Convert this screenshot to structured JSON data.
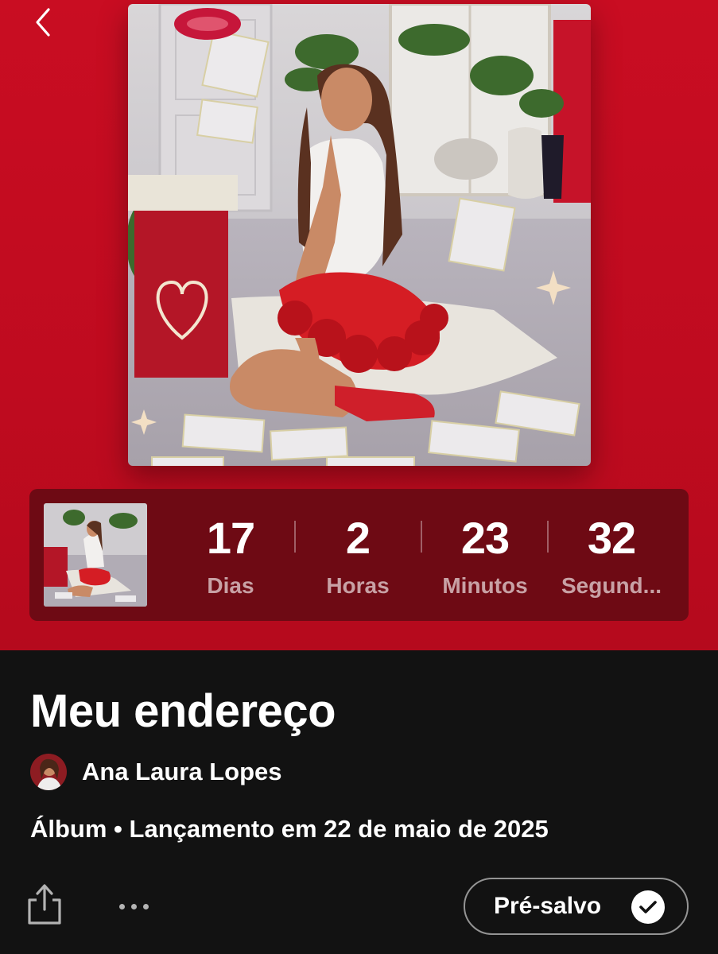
{
  "colors": {
    "hero_red": "#c90d22",
    "countdown_bg": "#6e0a14",
    "page_bg": "#121212"
  },
  "header": {
    "back_icon": "chevron-left-icon"
  },
  "countdown": {
    "units": [
      {
        "value": "17",
        "label": "Dias"
      },
      {
        "value": "2",
        "label": "Horas"
      },
      {
        "value": "23",
        "label": "Minutos"
      },
      {
        "value": "32",
        "label": "Segund..."
      }
    ]
  },
  "album": {
    "title": "Meu endereço",
    "artist": "Ana Laura Lopes",
    "meta": "Álbum • Lançamento em 22 de maio de 2025"
  },
  "actions": {
    "share_icon": "share-icon",
    "more_icon": "more-options-icon",
    "presave_label": "Pré-salvo",
    "presave_icon": "check-circle-icon"
  }
}
